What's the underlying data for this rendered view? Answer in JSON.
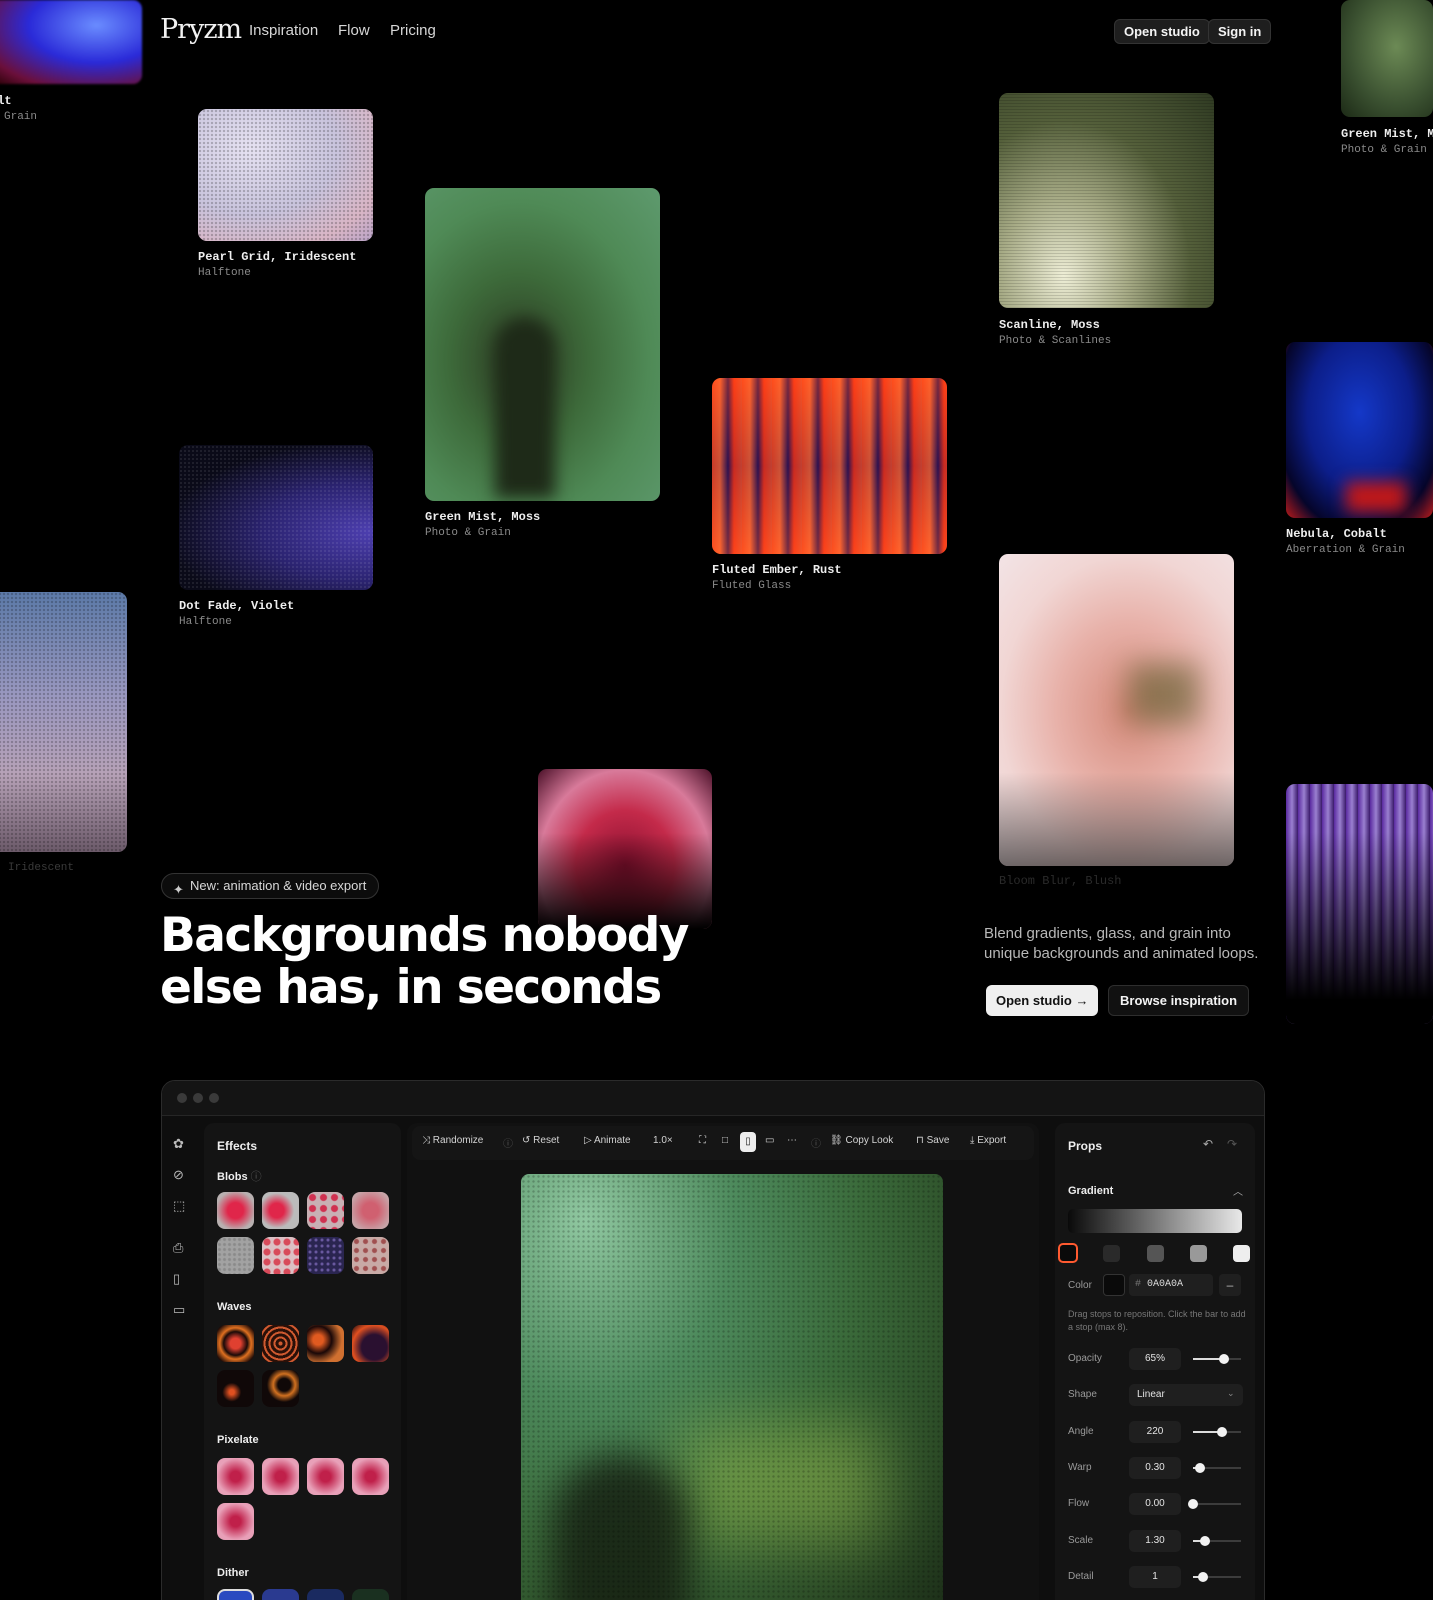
{
  "nav": {
    "logo": "Pryzm",
    "links": [
      "Inspiration",
      "Flow",
      "Pricing"
    ],
    "open_studio": "Open studio",
    "sign_in": "Sign in"
  },
  "gallery": [
    {
      "title": "alt",
      "sub": "Grain"
    },
    {
      "title": "Pearl Grid, Iridescent",
      "sub": "Halftone"
    },
    {
      "title": "Green Mist, Moss",
      "sub": "Photo & Grain"
    },
    {
      "title": "Scanline, Moss",
      "sub": "Photo & Scanlines"
    },
    {
      "title": "Green Mist, M",
      "sub": "Photo & Grain"
    },
    {
      "title": "Fluted Ember, Rust",
      "sub": "Fluted Glass"
    },
    {
      "title": "Nebula, Cobalt",
      "sub": "Aberration & Grain"
    },
    {
      "title": "Dot Fade, Violet",
      "sub": "Halftone"
    },
    {
      "title": "",
      "sub": "Iridescent"
    },
    {
      "title": "Bloom Blur, Blush",
      "sub": ""
    }
  ],
  "hero": {
    "badge": "New: animation & video export",
    "headline_1": "Backgrounds nobody",
    "headline_2": "else has, in seconds",
    "subtext": "Blend gradients, glass, and grain into unique backgrounds and animated loops.",
    "cta_primary": "Open studio",
    "cta_secondary": "Browse inspiration"
  },
  "studio": {
    "effects_title": "Effects",
    "sections": [
      "Blobs",
      "Waves",
      "Pixelate",
      "Dither"
    ],
    "toolbar": {
      "randomize": "Randomize",
      "reset": "Reset",
      "animate": "Animate",
      "speed": "1.0×",
      "copy_look": "Copy Look",
      "save": "Save",
      "export": "Export"
    },
    "props": {
      "title": "Props",
      "gradient": "Gradient",
      "color_label": "Color",
      "color_hex": "0A0A0A",
      "hint": "Drag stops to reposition. Click the bar to add a stop (max 8).",
      "rows": [
        {
          "label": "Opacity",
          "value": "65%",
          "level": 0.65
        },
        {
          "label": "Shape",
          "value": "Linear"
        },
        {
          "label": "Angle",
          "value": "220",
          "level": 0.61
        },
        {
          "label": "Warp",
          "value": "0.30",
          "level": 0.15
        },
        {
          "label": "Flow",
          "value": "0.00",
          "level": 0.0
        },
        {
          "label": "Scale",
          "value": "1.30",
          "level": 0.26
        },
        {
          "label": "Detail",
          "value": "1",
          "level": 0.2
        }
      ]
    }
  }
}
